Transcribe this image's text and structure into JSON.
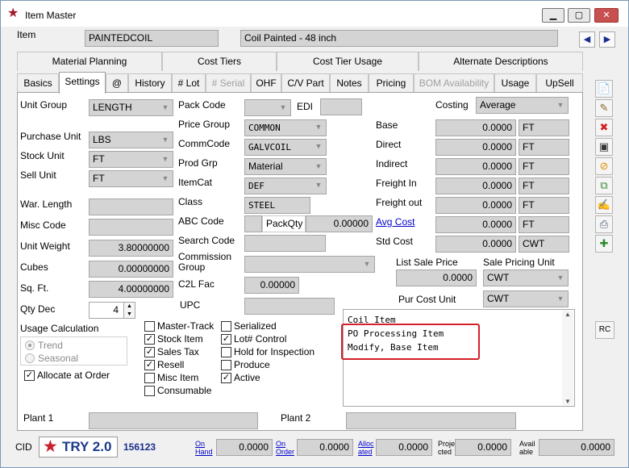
{
  "window": {
    "title": "Item Master"
  },
  "item": {
    "label": "Item",
    "code": "PAINTEDCOIL",
    "description": "Coil Painted - 48 inch"
  },
  "tabs_top": [
    "Material Planning",
    "Cost Tiers",
    "Cost Tier Usage",
    "Alternate Descriptions"
  ],
  "tabs_bottom": [
    {
      "label": "Basics"
    },
    {
      "label": "Settings"
    },
    {
      "label": "@"
    },
    {
      "label": "History"
    },
    {
      "label": "# Lot"
    },
    {
      "label": "# Serial"
    },
    {
      "label": "OHF"
    },
    {
      "label": "C/V Part"
    },
    {
      "label": "Notes"
    },
    {
      "label": "Pricing"
    },
    {
      "label": "BOM Availability"
    },
    {
      "label": "Usage"
    },
    {
      "label": "UpSell"
    }
  ],
  "left": {
    "unit_group_label": "Unit Group",
    "unit_group": "LENGTH",
    "purchase_unit_label": "Purchase Unit",
    "purchase_unit": "LBS",
    "stock_unit_label": "Stock Unit",
    "stock_unit": "FT",
    "sell_unit_label": "Sell Unit",
    "sell_unit": "FT",
    "war_length_label": "War. Length",
    "misc_code_label": "Misc Code",
    "unit_weight_label": "Unit Weight",
    "unit_weight": "3.80000000",
    "cubes_label": "Cubes",
    "cubes": "0.00000000",
    "sqft_label": "Sq. Ft.",
    "sqft": "4.00000000",
    "qty_dec_label": "Qty Dec",
    "qty_dec": "4"
  },
  "middle": {
    "pack_code_label": "Pack Code",
    "edi_label": "EDI",
    "price_group_label": "Price Group",
    "price_group": "COMMON",
    "commcode_label": "CommCode",
    "commcode": "GALVCOIL",
    "prod_grp_label": "Prod Grp",
    "prod_grp": "Material",
    "itemcat_label": "ItemCat",
    "itemcat": "DEF",
    "class_label": "Class",
    "class": "STEEL",
    "abc_code_label": "ABC Code",
    "packqty_label": "PackQty",
    "packqty": "0.00000",
    "search_code_label": "Search Code",
    "commission_group_label": "Commission\nGroup",
    "c2l_fac_label": "C2L Fac",
    "c2l_fac": "0.00000",
    "upc_label": "UPC"
  },
  "costing": {
    "label": "Costing",
    "method": "Average",
    "rows": [
      {
        "label": "Base",
        "value": "0.0000",
        "unit": "FT"
      },
      {
        "label": "Direct",
        "value": "0.0000",
        "unit": "FT"
      },
      {
        "label": "Indirect",
        "value": "0.0000",
        "unit": "FT"
      },
      {
        "label": "Freight In",
        "value": "0.0000",
        "unit": "FT"
      },
      {
        "label": "Freight out",
        "value": "0.0000",
        "unit": "FT"
      },
      {
        "label": "Avg Cost",
        "value": "0.0000",
        "unit": "FT"
      },
      {
        "label": "Std Cost",
        "value": "0.0000",
        "unit": "CWT"
      }
    ],
    "list_sale_price_label": "List Sale Price",
    "list_sale_price": "0.0000",
    "sale_pricing_unit_label": "Sale Pricing Unit",
    "sale_pricing_unit": "CWT",
    "pur_cost_unit_label": "Pur Cost Unit",
    "pur_cost_unit": "CWT"
  },
  "notes": {
    "lines": [
      "Coil Item",
      "PO Processing Item",
      "Modify, Base Item"
    ]
  },
  "usage_calc": {
    "label": "Usage Calculation",
    "trend": "Trend",
    "seasonal": "Seasonal",
    "allocate_label": "Allocate at Order"
  },
  "checks": {
    "col1": [
      {
        "label": "Master-Track",
        "checked": false
      },
      {
        "label": "Stock Item",
        "checked": true
      },
      {
        "label": "Sales Tax",
        "checked": true
      },
      {
        "label": "Resell",
        "checked": true
      },
      {
        "label": "Misc Item",
        "checked": false
      },
      {
        "label": "Consumable",
        "checked": false
      }
    ],
    "col2": [
      {
        "label": "Serialized",
        "checked": false
      },
      {
        "label": "Lot# Control",
        "checked": true
      },
      {
        "label": "Hold for Inspection",
        "checked": false
      },
      {
        "label": "Produce",
        "checked": false
      },
      {
        "label": "Active",
        "checked": true
      }
    ]
  },
  "plants": {
    "plant1_label": "Plant 1",
    "plant2_label": "Plant 2"
  },
  "footer": {
    "cid_label": "CID",
    "logo_text": "TRY 2.0",
    "cid": "156123",
    "on_hand_a": "On",
    "on_hand_b": "Hand",
    "on_hand": "0.0000",
    "on_order_a": "On",
    "on_order_b": "Order",
    "on_order": "0.0000",
    "alloc_a": "Alloc",
    "alloc_b": "ated",
    "allocated": "0.0000",
    "proj_a": "Proje",
    "proj_b": "cted",
    "projected": "0.0000",
    "avail_a": "Avail",
    "avail_b": "able",
    "available": "0.0000"
  },
  "side_buttons": [
    "new-icon",
    "edit-icon",
    "delete-icon",
    "save-icon",
    "cancel-icon",
    "copy-icon",
    "report-icon",
    "print-icon",
    "tools-icon"
  ],
  "rc_label": "RC"
}
